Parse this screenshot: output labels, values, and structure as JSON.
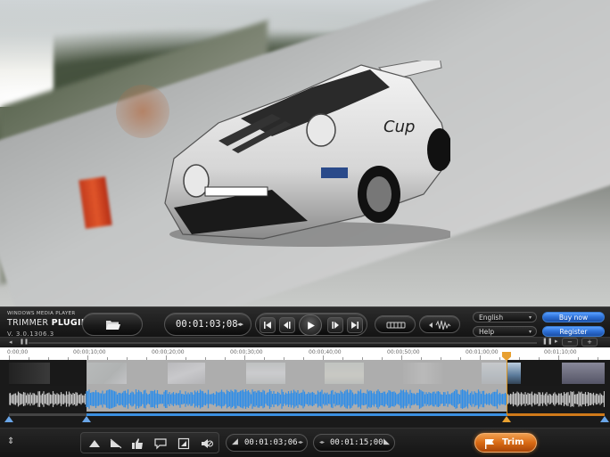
{
  "branding": {
    "product_small": "WINDOWS MEDIA PLAYER",
    "product_name_prefix": "TRIMMER ",
    "product_name_bold": "PLUGIN",
    "version": "V. 3.0.1306.3"
  },
  "player": {
    "current_time": "00:01:03;08"
  },
  "menus": {
    "language": "English",
    "help": "Help"
  },
  "buttons": {
    "buy_now": "Buy now",
    "register": "Register",
    "trim": "Trim"
  },
  "timeline": {
    "tick_labels": [
      "0:00;00",
      "00:00;10;00",
      "00:00;20;00",
      "00:00;30;00",
      "00:00;40;00",
      "00:00;50;00",
      "00:01;00;00",
      "00:01;10;00"
    ]
  },
  "trim": {
    "start_time": "00:01:03;06",
    "end_time": "00:01:15;00"
  },
  "icons": [
    "open-folder-icon",
    "skip-to-start-icon",
    "step-back-icon",
    "play-icon",
    "step-forward-icon",
    "skip-to-end-icon",
    "effects-icon",
    "volume-icon",
    "zoom-out-icon",
    "zoom-in-icon",
    "expand-icon",
    "fade-in-icon",
    "fade-out-icon",
    "thumbs-up-icon",
    "comment-icon",
    "crop-icon",
    "mute-icon",
    "set-start-icon",
    "set-end-icon",
    "flag-icon"
  ],
  "colors": {
    "selection_blue": "#3b8fe0",
    "playhead_orange": "#d8921e",
    "trim_orange": "#d96a14",
    "buy_blue": "#2d6fd6"
  }
}
